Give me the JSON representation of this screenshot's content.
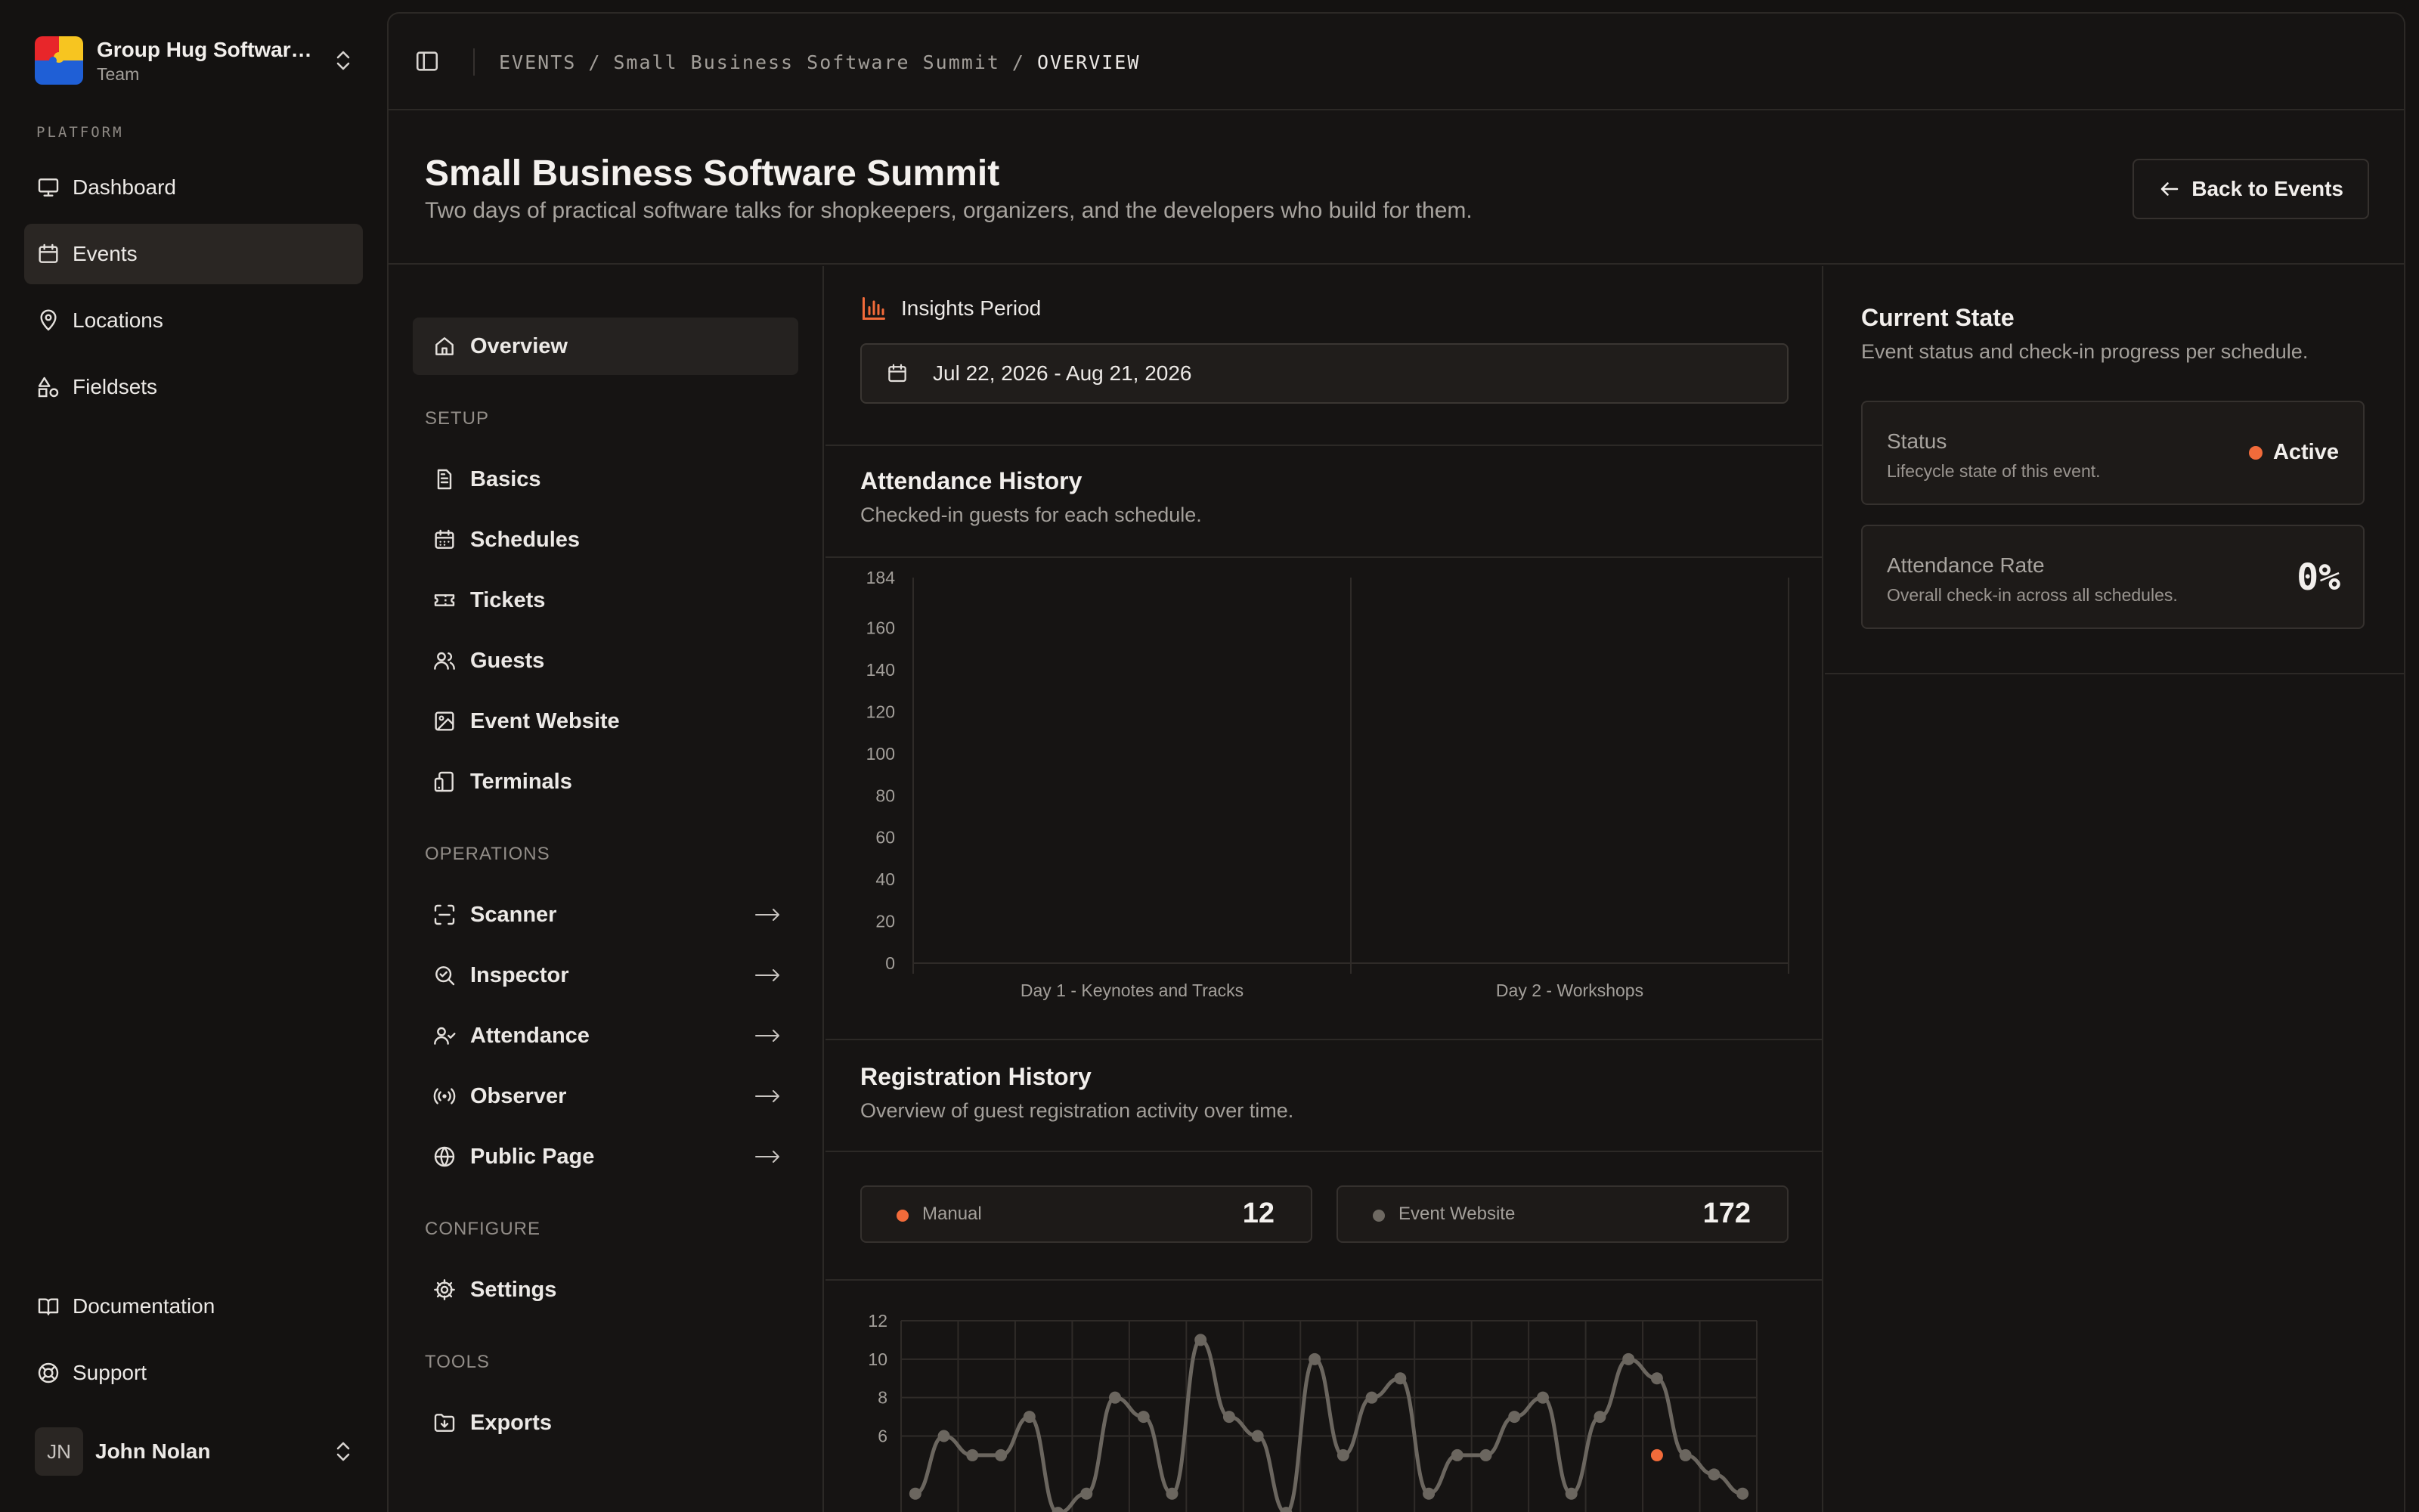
{
  "team": {
    "name": "Group Hug Software...",
    "subtitle": "Team"
  },
  "sidebar": {
    "section_label": "PLATFORM",
    "items": [
      {
        "label": "Dashboard",
        "icon": "monitor-icon"
      },
      {
        "label": "Events",
        "icon": "calendar-icon",
        "active": true
      },
      {
        "label": "Locations",
        "icon": "map-pin-icon"
      },
      {
        "label": "Fieldsets",
        "icon": "shapes-icon"
      }
    ],
    "footer_items": [
      {
        "label": "Documentation",
        "icon": "book-icon"
      },
      {
        "label": "Support",
        "icon": "life-buoy-icon"
      }
    ],
    "user": {
      "initials": "JN",
      "name": "John Nolan"
    }
  },
  "breadcrumb": {
    "root": "EVENTS",
    "separator": "/",
    "event": "Small Business Software Summit",
    "current": "OVERVIEW"
  },
  "header": {
    "title": "Small Business Software Summit",
    "subtitle": "Two days of practical software talks for shopkeepers, organizers, and the developers who build for them.",
    "back_label": "Back to Events"
  },
  "section_nav": {
    "overview": "Overview",
    "setup_label": "SETUP",
    "setup": [
      "Basics",
      "Schedules",
      "Tickets",
      "Guests",
      "Event Website",
      "Terminals"
    ],
    "operations_label": "OPERATIONS",
    "operations": [
      "Scanner",
      "Inspector",
      "Attendance",
      "Observer",
      "Public Page"
    ],
    "configure_label": "CONFIGURE",
    "configure": [
      "Settings"
    ],
    "tools_label": "TOOLS",
    "tools": [
      "Exports"
    ]
  },
  "insights": {
    "label": "Insights Period",
    "date_range": "Jul 22, 2026 - Aug 21, 2026"
  },
  "attendance": {
    "title": "Attendance History",
    "subtitle": "Checked-in guests for each schedule."
  },
  "registration": {
    "title": "Registration History",
    "subtitle": "Overview of guest registration activity over time.",
    "manual_label": "Manual",
    "manual_value": "12",
    "website_label": "Event Website",
    "website_value": "172"
  },
  "current_state": {
    "title": "Current State",
    "subtitle": "Event status and check-in progress per schedule.",
    "status_title": "Status",
    "status_desc": "Lifecycle state of this event.",
    "status_value": "Active",
    "rate_title": "Attendance Rate",
    "rate_desc": "Overall check-in across all schedules.",
    "rate_value": "0%"
  },
  "colors": {
    "accent": "#f26b3a",
    "website_series": "#6e6962",
    "muted_line": "#6b665f"
  },
  "chart_data": [
    {
      "type": "bar",
      "title": "Attendance History",
      "categories": [
        "Day 1 - Keynotes and Tracks",
        "Day 2 - Workshops"
      ],
      "values": [
        0,
        0
      ],
      "ylim": [
        0,
        184
      ],
      "yticks": [
        0,
        20,
        40,
        60,
        80,
        100,
        120,
        140,
        160,
        184
      ],
      "grid": true
    },
    {
      "type": "line",
      "title": "Registration History",
      "x": [
        1,
        2,
        3,
        4,
        5,
        6,
        7,
        8,
        9,
        10,
        11,
        12,
        13,
        14,
        15,
        16,
        17,
        18,
        19,
        20,
        21,
        22,
        23,
        24,
        25,
        26,
        27,
        28,
        29,
        30
      ],
      "ylim": [
        0,
        12
      ],
      "yticks": [
        6,
        8,
        10,
        12
      ],
      "grid": true,
      "series": [
        {
          "name": "Event Website",
          "values": [
            3,
            6,
            5,
            5,
            7,
            2,
            3,
            8,
            7,
            3,
            11,
            7,
            6,
            2,
            10,
            5,
            8,
            9,
            3,
            5,
            5,
            7,
            8,
            3,
            7,
            10,
            9,
            5,
            4,
            3
          ]
        },
        {
          "name": "Manual",
          "values": [
            0,
            0,
            0,
            0,
            0,
            0,
            0,
            0,
            0,
            0,
            0,
            0,
            0,
            0,
            0,
            0,
            0,
            0,
            0,
            0,
            0,
            0,
            0,
            0,
            0,
            0,
            5,
            0,
            0,
            0
          ]
        }
      ]
    }
  ]
}
